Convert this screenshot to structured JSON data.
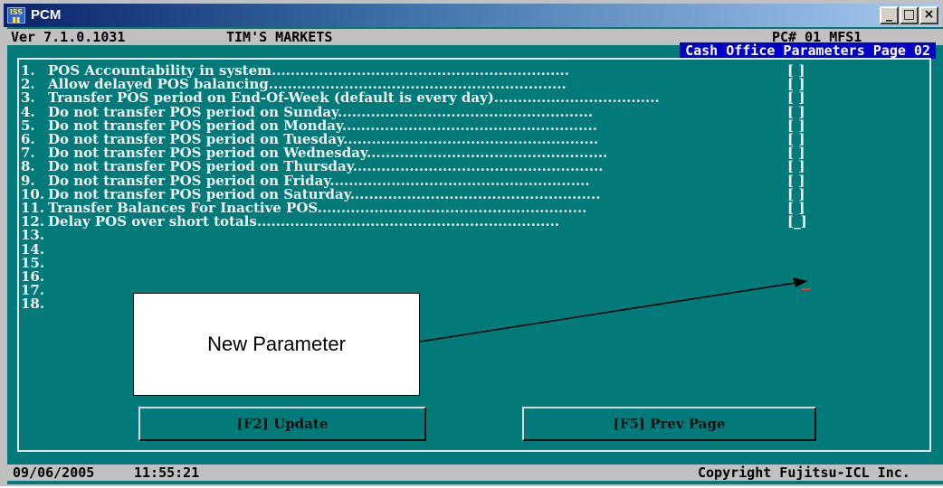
{
  "window": {
    "title": "PCM",
    "icon_name": "pcm-app-icon",
    "controls": {
      "minimize": "_",
      "maximize": "□",
      "close": "×"
    }
  },
  "header": {
    "version": "Ver 7.1.0.1031",
    "company": "TIM'S MARKETS",
    "terminal": "PC# 01 MFS1",
    "page_title": "Cash Office Parameters Page 02"
  },
  "parameters": [
    {
      "num": "1.",
      "label": "POS Accountability in system",
      "value": "[ ]"
    },
    {
      "num": "2.",
      "label": "Allow delayed POS balancing",
      "value": "[ ]"
    },
    {
      "num": "3.",
      "label": "Transfer POS period on End-Of-Week (default is every day)",
      "value": "[ ]"
    },
    {
      "num": "4.",
      "label": "Do not transfer POS period on Sunday",
      "value": "[ ]"
    },
    {
      "num": "5.",
      "label": "Do not transfer POS period on Monday",
      "value": "[ ]"
    },
    {
      "num": "6.",
      "label": "Do not transfer POS period on Tuesday",
      "value": "[ ]"
    },
    {
      "num": "7.",
      "label": "Do not transfer POS period on Wednesday",
      "value": "[ ]"
    },
    {
      "num": "8.",
      "label": "Do not transfer POS period on Thursday",
      "value": "[ ]"
    },
    {
      "num": "9.",
      "label": "Do not transfer POS period on Friday",
      "value": "[ ]"
    },
    {
      "num": "10.",
      "label": "Do not transfer POS period on Saturday",
      "value": "[ ]"
    },
    {
      "num": "11.",
      "label": "Transfer Balances For Inactive POS",
      "value": "[ ]"
    },
    {
      "num": "12.",
      "label": "Delay POS over short totals",
      "value": "[_]"
    },
    {
      "num": "13.",
      "label": "",
      "value": ""
    },
    {
      "num": "14.",
      "label": "",
      "value": ""
    },
    {
      "num": "15.",
      "label": "",
      "value": ""
    },
    {
      "num": "16.",
      "label": "",
      "value": ""
    },
    {
      "num": "17.",
      "label": "",
      "value": ""
    },
    {
      "num": "18.",
      "label": "",
      "value": ""
    }
  ],
  "buttons": {
    "update": "[F2] Update",
    "prev_page": "[F5] Prev Page"
  },
  "callout": {
    "text": "New Parameter"
  },
  "footer": {
    "date": "09/06/2005",
    "time": "11:55:21",
    "copyright": "Copyright Fujitsu-ICL Inc."
  },
  "colors": {
    "console_bg": "#037a7a",
    "header_bg": "#0000c8",
    "cursor": "#ff2d2d"
  }
}
